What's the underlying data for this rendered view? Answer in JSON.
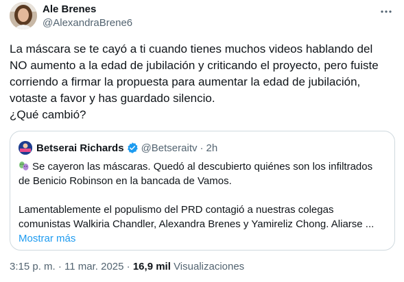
{
  "author": {
    "display_name": "Ale Brenes",
    "handle": "@AlexandraBrene6"
  },
  "more_icon": "more-horizontal-icon",
  "tweet": {
    "lines": [
      "La máscara se te cayó a ti cuando tienes muchos videos hablando del",
      "NO aumento a la edad de jubilación y criticando el proyecto, pero fuiste",
      "corriendo a firmar la propuesta para aumentar la edad de jubilación,",
      "votaste a favor y has guardado silencio.",
      "¿Qué cambió?"
    ]
  },
  "quote": {
    "display_name": "Betserai Richards",
    "verified": true,
    "verified_icon": "verified-badge-icon",
    "handle": "@Betseraitv",
    "separator": "·",
    "time": "2h",
    "emoji": "performing-arts-masks-icon",
    "line1": "Se cayeron las máscaras. Quedó al descubierto quiénes son los infiltrados",
    "line2": "de Benicio Robinson en la bancada de Vamos.",
    "line3": "Lamentablemente el populismo del PRD contagió a nuestras colegas",
    "line4": "comunistas Walkiria Chandler, Alexandra Brenes y Yamireliz Chong. Aliarse ...",
    "show_more": "Mostrar más"
  },
  "meta": {
    "time": "3:15 p. m.",
    "separator": "·",
    "date": "11 mar. 2025",
    "separator2": "·",
    "views_count": "16,9 mil",
    "views_label": "Visualizaciones"
  },
  "colors": {
    "text": "#0f1419",
    "secondary": "#536471",
    "link": "#1d9bf0",
    "border": "#cfd9de"
  }
}
